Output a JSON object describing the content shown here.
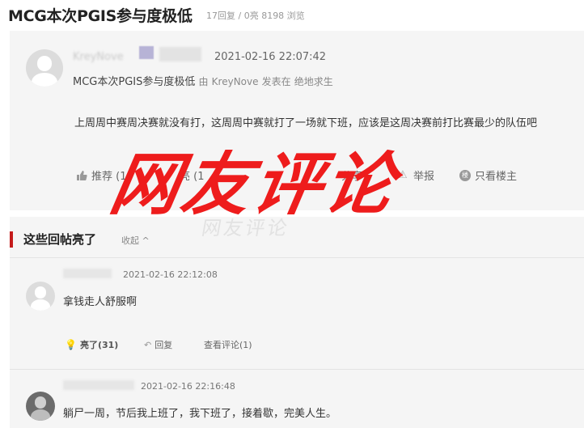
{
  "thread": {
    "title": "MCG本次PGIS参与度极低",
    "stats": "17回复 / 0亮 8198 浏览"
  },
  "post": {
    "author_blurred": "KreyNove",
    "time": "2021-02-16 22:07:42",
    "subtitle_title": "MCG本次PGIS参与度极低",
    "subtitle_by": "由",
    "subtitle_author": "KreyNove",
    "subtitle_in": "发表在",
    "subtitle_board": "绝地求生",
    "body": "上周周中赛周决赛就没有打，这周周中赛就打了一场就下班，应该是这周决赛前打比赛最少的队伍吧",
    "actions": {
      "recommend": "推荐 (1",
      "light": "亮 (1",
      "share": "分享",
      "report": "举报",
      "only_op": "只看楼主"
    }
  },
  "watermark": "网友评论",
  "hot": {
    "title": "这些回帖亮了",
    "collapse": "收起 ^",
    "replies": [
      {
        "time": "2021-02-16 22:12:08",
        "text": "拿钱走人舒服啊",
        "light": "亮了(31)",
        "reply": "回复",
        "view": "查看评论(1)"
      },
      {
        "time": "2021-02-16 22:16:48",
        "text": "躺尸一周，节后我上班了，我下班了，接着歇，完美人生。"
      }
    ]
  },
  "colors": {
    "accent_red": "#c41b1b",
    "watermark_red": "#ee1c1c",
    "panel_bg": "#f5f5f5"
  }
}
